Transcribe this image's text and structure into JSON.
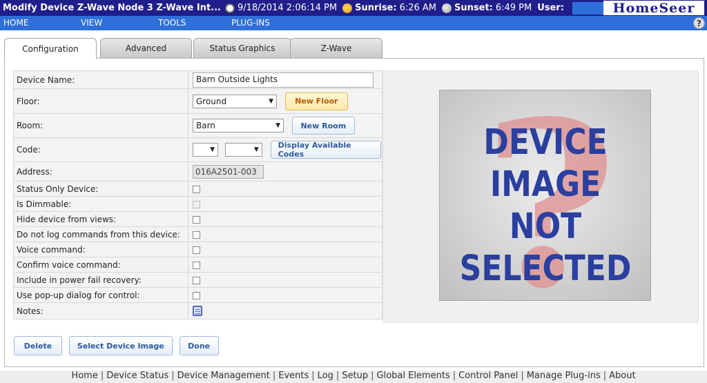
{
  "header": {
    "title": "Modify Device Z-Wave Node 3 Z-Wave Int...",
    "datetime": "9/18/2014 2:06:14 PM",
    "sunrise_label": "Sunrise:",
    "sunrise_value": "6:26 AM",
    "sunset_label": "Sunset:",
    "sunset_value": "6:49 PM",
    "user_label": "User:",
    "logo": "HomeSeer"
  },
  "menu": {
    "items": [
      "HOME",
      "VIEW",
      "TOOLS",
      "PLUG-INS"
    ],
    "help": "?"
  },
  "tabs": [
    "Configuration",
    "Advanced",
    "Status Graphics",
    "Z-Wave"
  ],
  "form": {
    "device_name_label": "Device Name:",
    "device_name_value": "Barn Outside Lights",
    "floor_label": "Floor:",
    "floor_value": "Ground",
    "new_floor_button": "New Floor",
    "room_label": "Room:",
    "room_value": "Barn",
    "new_room_button": "New Room",
    "code_label": "Code:",
    "code_value_1": "",
    "code_value_2": "",
    "display_codes_button": "Display Available Codes",
    "address_label": "Address:",
    "address_value": "016A2501-003",
    "checkbox_rows": [
      {
        "label": "Status Only Device:",
        "checked": false,
        "disabled": false
      },
      {
        "label": "Is Dimmable:",
        "checked": false,
        "disabled": true
      },
      {
        "label": "Hide device from views:",
        "checked": false,
        "disabled": false
      },
      {
        "label": "Do not log commands from this device:",
        "checked": false,
        "disabled": false
      },
      {
        "label": "Voice command:",
        "checked": false,
        "disabled": false
      },
      {
        "label": "Confirm voice command:",
        "checked": false,
        "disabled": false
      },
      {
        "label": "Include in power fail recovery:",
        "checked": false,
        "disabled": false
      },
      {
        "label": "Use pop-up dialog for control:",
        "checked": false,
        "disabled": false
      }
    ],
    "notes_label": "Notes:"
  },
  "device_image": {
    "lines": [
      "DEVICE",
      "IMAGE",
      "NOT",
      "SELECTED"
    ],
    "text_color": "#2a3f9e",
    "question_color": "#e08f8f"
  },
  "bottom_buttons": [
    "Delete",
    "Select Device Image",
    "Done"
  ],
  "footer": {
    "links": [
      "Home",
      "Device Status",
      "Device Management",
      "Events",
      "Log",
      "Setup",
      "Global Elements",
      "Control Panel",
      "Manage Plug-ins",
      "About"
    ]
  },
  "colors": {
    "header_bg": "#1f1e8a",
    "menu_bg": "#2f6fd9",
    "button_text": "#2c5aa0",
    "highlight_button_text": "#b85b00"
  }
}
